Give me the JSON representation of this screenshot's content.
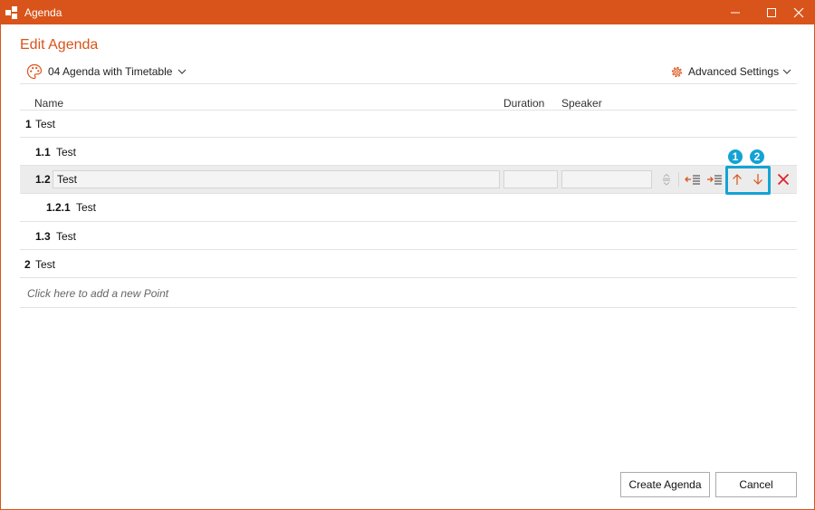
{
  "window": {
    "title": "Agenda"
  },
  "header": {
    "heading": "Edit Agenda",
    "template_label": "04 Agenda with Timetable",
    "advanced_settings_label": "Advanced Settings"
  },
  "columns": {
    "name": "Name",
    "duration": "Duration",
    "speaker": "Speaker"
  },
  "items": [
    {
      "num": "1",
      "name": "Test"
    },
    {
      "num": "1.1",
      "name": "Test"
    },
    {
      "num": "1.2",
      "name": "Test",
      "duration": "",
      "speaker": ""
    },
    {
      "num": "1.2.1",
      "name": "Test"
    },
    {
      "num": "1.3",
      "name": "Test"
    },
    {
      "num": "2",
      "name": "Test"
    }
  ],
  "add_point_text": "Click here to add a new Point",
  "badges": [
    "1",
    "2"
  ],
  "buttons": {
    "create": "Create Agenda",
    "cancel": "Cancel"
  },
  "colors": {
    "accent": "#d9541a",
    "highlight": "#13a3d4",
    "delete": "#e0232c"
  },
  "icons": [
    "app-logo-icon",
    "minimize-icon",
    "maximize-icon",
    "close-icon",
    "palette-icon",
    "chevron-down-icon",
    "gear-icon",
    "reorder-handle-icon",
    "outdent-icon",
    "indent-icon",
    "move-up-icon",
    "move-down-icon",
    "delete-icon"
  ]
}
